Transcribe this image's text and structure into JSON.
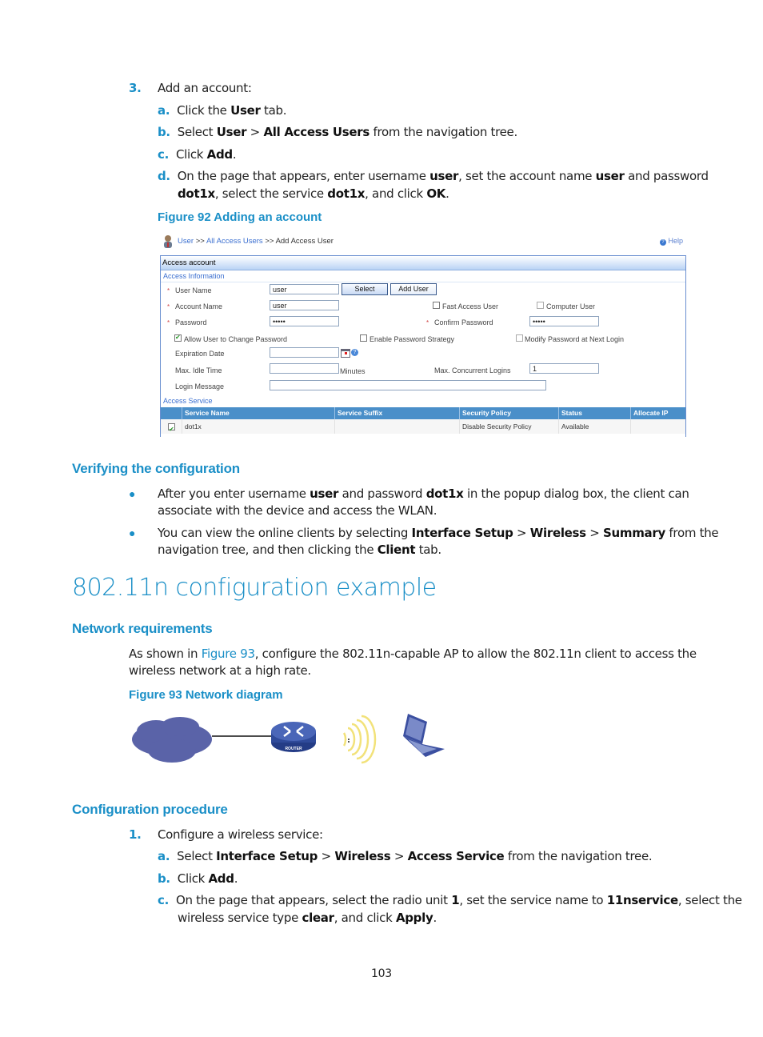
{
  "step3": {
    "number": "3.",
    "text": "Add an account:",
    "substeps": [
      {
        "letter": "a.",
        "parts": [
          "Click the ",
          "User",
          " tab."
        ]
      },
      {
        "letter": "b.",
        "parts": [
          "Select ",
          "User",
          " > ",
          "All Access Users",
          " from the navigation tree."
        ]
      },
      {
        "letter": "c.",
        "parts": [
          "Click ",
          "Add",
          "."
        ]
      },
      {
        "letter": "d.",
        "line1": [
          "On the page that appears, enter username ",
          "user",
          ", set the account name ",
          "user",
          " and password"
        ],
        "line2": [
          "dot1x",
          ", select the service ",
          "dot1x",
          ", and click ",
          "OK",
          "."
        ]
      }
    ]
  },
  "figure92": {
    "caption": "Figure 92 Adding an account",
    "breadcrumb": [
      "User",
      ">>",
      "All Access Users",
      ">>",
      "Add Access User"
    ],
    "help": "Help",
    "panel_title": "Access account",
    "section_info": "Access Information",
    "fields": {
      "user_name": {
        "label": "User Name",
        "value": "user"
      },
      "account_name": {
        "label": "Account Name",
        "value": "user"
      },
      "password": {
        "label": "Password",
        "value": "•••••"
      },
      "confirm_password": {
        "label": "Confirm Password",
        "value": "•••••"
      },
      "expiration_date": {
        "label": "Expiration Date",
        "value": ""
      },
      "max_idle_time": {
        "label": "Max. Idle Time",
        "value": "",
        "unit": "Minutes"
      },
      "max_concurrent_logins": {
        "label": "Max. Concurrent Logins",
        "value": "1"
      },
      "login_message": {
        "label": "Login Message",
        "value": ""
      }
    },
    "buttons": {
      "select": "Select",
      "add_user": "Add User"
    },
    "checkboxes": {
      "fast_access_user": {
        "label": "Fast Access User",
        "checked": false
      },
      "computer_user": {
        "label": "Computer User",
        "checked": false
      },
      "allow_change_password": {
        "label": "Allow User to Change Password",
        "checked": true
      },
      "enable_password_strategy": {
        "label": "Enable Password Strategy",
        "checked": false
      },
      "modify_password_next_login": {
        "label": "Modify Password at Next Login",
        "checked": false
      }
    },
    "section_service": "Access Service",
    "table": {
      "columns": [
        "",
        "Service Name",
        "Service Suffix",
        "Security Policy",
        "Status",
        "Allocate IP"
      ],
      "rows": [
        {
          "checked": true,
          "service_name": "dot1x",
          "service_suffix": "",
          "security_policy": "Disable Security Policy",
          "status": "Available",
          "allocate_ip": ""
        }
      ]
    }
  },
  "verify": {
    "heading": "Verifying the configuration",
    "bullets": [
      {
        "line1": [
          "After you enter username ",
          "user",
          " and password ",
          "dot1x",
          " in the popup dialog box, the client can"
        ],
        "line2": "associate with the device and access the WLAN."
      },
      {
        "line1": [
          "You can view the online clients by selecting ",
          "Interface Setup",
          " > ",
          "Wireless",
          " > ",
          "Summary",
          " from the"
        ],
        "line2": [
          "navigation tree, and then clicking the ",
          "Client",
          " tab."
        ]
      }
    ]
  },
  "example": {
    "title": "802.11n configuration example",
    "netreq_heading": "Network requirements",
    "netreq_line1": [
      "As shown in ",
      "Figure 93",
      ", configure the 802.11n-capable AP to allow the 802.11n client to access the"
    ],
    "netreq_line2": "wireless network at a high rate.",
    "figure93_caption": "Figure 93 Network diagram",
    "diagram": {
      "nodes": [
        "cloud-network",
        "router",
        "wireless-signal",
        "laptop-client"
      ],
      "router_label": "ROUTER",
      "colors": {
        "cloud": "#5a63a8",
        "router": "#2f4a9a",
        "signal": "#f2e27a",
        "laptop": "#3b4fa0"
      }
    },
    "proc_heading": "Configuration procedure",
    "step1": {
      "number": "1.",
      "text": "Configure a wireless service:"
    },
    "substeps": [
      {
        "letter": "a.",
        "parts": [
          "Select ",
          "Interface Setup",
          " > ",
          "Wireless",
          " > ",
          "Access Service",
          " from the navigation tree."
        ]
      },
      {
        "letter": "b.",
        "parts": [
          "Click ",
          "Add",
          "."
        ]
      },
      {
        "letter": "c.",
        "line1": [
          "On the page that appears, select the radio unit ",
          "1",
          ", set the service name to ",
          "11nservice",
          ", select the"
        ],
        "line2": [
          "wireless service type ",
          "clear",
          ", and click ",
          "Apply",
          "."
        ]
      }
    ]
  },
  "page_number": "103",
  "colors": {
    "accent": "#1a8fc7",
    "table_header": "#4a8fc9",
    "panel_border": "#6a8fd0"
  }
}
